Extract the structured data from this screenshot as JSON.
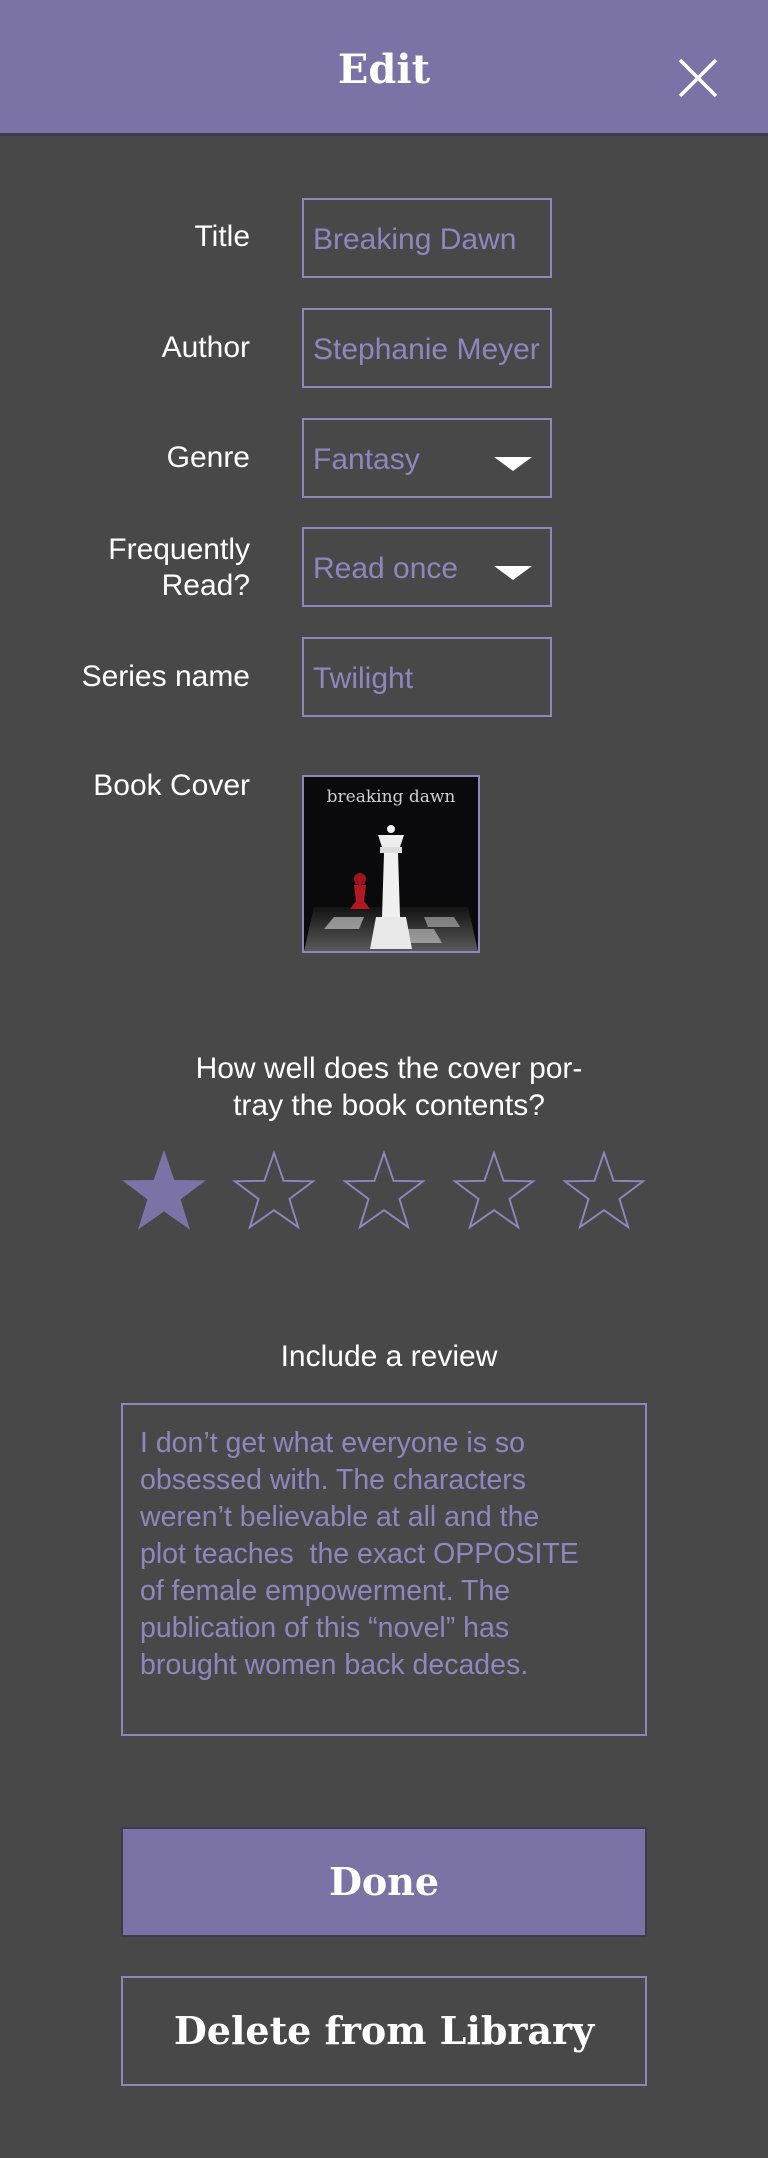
{
  "header": {
    "title": "Edit",
    "close_icon": "close-icon"
  },
  "form": {
    "title": {
      "label": "Title",
      "value": "Breaking Dawn"
    },
    "author": {
      "label": "Author",
      "value": "Stephanie Meyer"
    },
    "genre": {
      "label": "Genre",
      "value": "Fantasy"
    },
    "frequency": {
      "label_line1": "Frequently",
      "label_line2": "Read?",
      "value": "Read once"
    },
    "series": {
      "label": "Series name",
      "value": "Twilight"
    },
    "cover": {
      "label": "Book Cover",
      "image_text": "breaking dawn"
    }
  },
  "rating": {
    "question_line1": "How well does the cover por-",
    "question_line2": "tray the book contents?",
    "value": 1,
    "max": 5
  },
  "review": {
    "label": "Include a review",
    "text": "I don’t get what everyone is so\nobsessed with. The characters\nweren’t believable at all and the\nplot teaches  the exact OPPOSITE\nof female empowerment. The\npublication of this “novel” has\nbrought women back decades."
  },
  "buttons": {
    "done": "Done",
    "delete": "Delete from Library"
  },
  "colors": {
    "accent": "#7b73a6",
    "field_border": "#8e86bd",
    "background": "#484848"
  }
}
